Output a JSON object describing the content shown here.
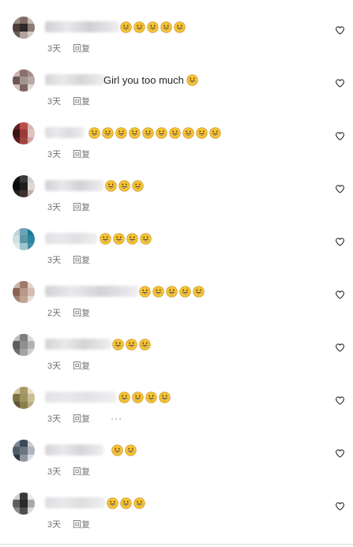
{
  "comments": [
    {
      "text": "",
      "emoji_count": 5,
      "time": "3天",
      "reply": "回复",
      "show_more": false,
      "avatar": [
        "#9b8a84",
        "#7e6d66",
        "#c7b9b3",
        "#4a3d3a",
        "#2f2a29",
        "#8c7b75",
        "#6a5a55",
        "#b3a39d",
        "#d8ccc7"
      ],
      "name_color": "#cfcfd2"
    },
    {
      "text": "Girl you too much",
      "emoji_count": 1,
      "time": "3天",
      "reply": "回复",
      "show_more": false,
      "avatar": [
        "#c9b3b0",
        "#8a6f6c",
        "#a88f8a",
        "#6d5552",
        "#a29491",
        "#b9aaa7",
        "#d3c4c1",
        "#7b6663",
        "#e2d8d6"
      ],
      "name_color": "#d6d6d9"
    },
    {
      "text": "",
      "emoji_count": 10,
      "time": "3天",
      "reply": "回复",
      "show_more": false,
      "avatar": [
        "#6b1f1f",
        "#b84f4a",
        "#d8b5b0",
        "#3b1414",
        "#9a3b37",
        "#e1c2bd",
        "#5a1c1c",
        "#a1453f",
        "#cfa7a1"
      ],
      "name_color": "#dcdcdf"
    },
    {
      "text": "",
      "emoji_count": 3,
      "time": "3天",
      "reply": "回复",
      "show_more": false,
      "avatar": [
        "#111111",
        "#3a3a3a",
        "#cfcfcf",
        "#0b0b0b",
        "#1f1f1f",
        "#e0d7d3",
        "#222222",
        "#3d2f2b",
        "#bfb2ad"
      ],
      "name_color": "#d2d2d6"
    },
    {
      "text": "",
      "emoji_count": 4,
      "time": "3天",
      "reply": "回复",
      "show_more": false,
      "avatar": [
        "#b9d3db",
        "#6aa3b6",
        "#1f7893",
        "#cfdfe4",
        "#5f97aa",
        "#2a87a0",
        "#dfe9ec",
        "#a0c4cf",
        "#3f8ea5"
      ],
      "name_color": "#e0e0e3"
    },
    {
      "text": "",
      "emoji_count": 5,
      "time": "2天",
      "reply": "回复",
      "show_more": false,
      "avatar": [
        "#cdb3a6",
        "#9e7a6b",
        "#e3cfc5",
        "#8a6253",
        "#b8968a",
        "#d4bcb1",
        "#a38374",
        "#c2a497",
        "#e8d9d2"
      ],
      "name_color": "#d3d3d6"
    },
    {
      "text": "",
      "emoji_count": 3,
      "time": "3天",
      "reply": "回复",
      "show_more": false,
      "avatar": [
        "#bcbcbc",
        "#7e7e7e",
        "#dcdcdc",
        "#5c5c5c",
        "#8f8f8f",
        "#b1b1b1",
        "#6d6d6d",
        "#a3a3a3",
        "#cfcfcf"
      ],
      "name_color": "#d4d4d7"
    },
    {
      "text": "",
      "emoji_count": 4,
      "time": "3天",
      "reply": "回复",
      "show_more": true,
      "avatar": [
        "#d4caa7",
        "#a89a68",
        "#e6dfc6",
        "#7d7144",
        "#9f935f",
        "#cbbf96",
        "#5e5431",
        "#8a7e4e",
        "#bcae82"
      ],
      "name_color": "#e3e3e6"
    },
    {
      "text": "",
      "emoji_count": 2,
      "time": "3天",
      "reply": "回复",
      "show_more": false,
      "avatar": [
        "#7a8694",
        "#3f4a58",
        "#c7ccd2",
        "#515c69",
        "#6c7683",
        "#aeb5be",
        "#2f3844",
        "#8e97a2",
        "#dadee2"
      ],
      "name_color": "#d5d5d8"
    },
    {
      "text": "",
      "emoji_count": 3,
      "time": "3天",
      "reply": "回复",
      "show_more": false,
      "avatar": [
        "#cfcfcf",
        "#3a3a3a",
        "#e7e7e7",
        "#5e5e5e",
        "#2b2b2b",
        "#a9a9a9",
        "#8a8a8a",
        "#4f4f4f",
        "#d9d9d9"
      ],
      "name_color": "#dedee1"
    }
  ],
  "icons": {
    "like": "heart-outline-icon",
    "emoji": "grinning-face-emoji",
    "more": "ellipsis-icon"
  },
  "more_glyph": "···"
}
